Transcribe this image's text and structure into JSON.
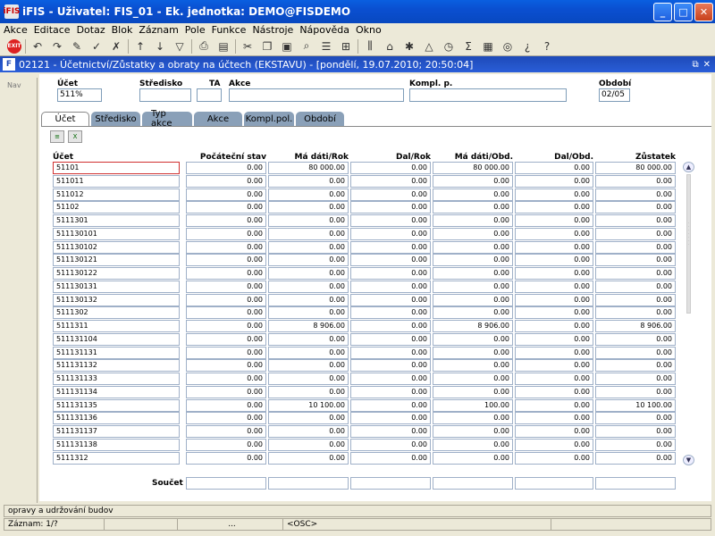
{
  "window": {
    "title": "iFIS - Uživatel: FIS_01 - Ek. jednotka: DEMO@FISDEMO",
    "app_icon": "iFIS"
  },
  "menu": [
    "Akce",
    "Editace",
    "Dotaz",
    "Blok",
    "Záznam",
    "Pole",
    "Funkce",
    "Nástroje",
    "Nápověda",
    "Okno"
  ],
  "toolbar": {
    "exit_label": "EXIT"
  },
  "child_window": {
    "title": "02121 - Účetnictví/Zůstatky a obraty na účtech (EKSTAVU) - [pondělí, 19.07.2010; 20:50:04]"
  },
  "nav": {
    "label": "Nav"
  },
  "filters": {
    "ucet_label": "Účet",
    "ucet_value": "511%",
    "stredisko_label": "Středisko",
    "stredisko_value": "",
    "ta_label": "TA",
    "ta_value": "",
    "akce_label": "Akce",
    "akce_value": "",
    "kompl_label": "Kompl. p.",
    "kompl_value": "",
    "obdobi_label": "Období",
    "obdobi_value": "02/05"
  },
  "tabs": [
    "Účet",
    "Středisko",
    "Typ akce",
    "Akce",
    "Kompl.pol.",
    "Období"
  ],
  "table": {
    "headers": [
      "Účet",
      "Počáteční stav",
      "Má dáti/Rok",
      "Dal/Rok",
      "Má dáti/Obd.",
      "Dal/Obd.",
      "Zůstatek"
    ],
    "rows": [
      [
        "51101",
        "0.00",
        "80 000.00",
        "0.00",
        "80 000.00",
        "0.00",
        "80 000.00"
      ],
      [
        "511011",
        "0.00",
        "0.00",
        "0.00",
        "0.00",
        "0.00",
        "0.00"
      ],
      [
        "511012",
        "0.00",
        "0.00",
        "0.00",
        "0.00",
        "0.00",
        "0.00"
      ],
      [
        "51102",
        "0.00",
        "0.00",
        "0.00",
        "0.00",
        "0.00",
        "0.00"
      ],
      [
        "5111301",
        "0.00",
        "0.00",
        "0.00",
        "0.00",
        "0.00",
        "0.00"
      ],
      [
        "511130101",
        "0.00",
        "0.00",
        "0.00",
        "0.00",
        "0.00",
        "0.00"
      ],
      [
        "511130102",
        "0.00",
        "0.00",
        "0.00",
        "0.00",
        "0.00",
        "0.00"
      ],
      [
        "511130121",
        "0.00",
        "0.00",
        "0.00",
        "0.00",
        "0.00",
        "0.00"
      ],
      [
        "511130122",
        "0.00",
        "0.00",
        "0.00",
        "0.00",
        "0.00",
        "0.00"
      ],
      [
        "511130131",
        "0.00",
        "0.00",
        "0.00",
        "0.00",
        "0.00",
        "0.00"
      ],
      [
        "511130132",
        "0.00",
        "0.00",
        "0.00",
        "0.00",
        "0.00",
        "0.00"
      ],
      [
        "5111302",
        "0.00",
        "0.00",
        "0.00",
        "0.00",
        "0.00",
        "0.00"
      ],
      [
        "5111311",
        "0.00",
        "8 906.00",
        "0.00",
        "8 906.00",
        "0.00",
        "8 906.00"
      ],
      [
        "511131104",
        "0.00",
        "0.00",
        "0.00",
        "0.00",
        "0.00",
        "0.00"
      ],
      [
        "511131131",
        "0.00",
        "0.00",
        "0.00",
        "0.00",
        "0.00",
        "0.00"
      ],
      [
        "511131132",
        "0.00",
        "0.00",
        "0.00",
        "0.00",
        "0.00",
        "0.00"
      ],
      [
        "511131133",
        "0.00",
        "0.00",
        "0.00",
        "0.00",
        "0.00",
        "0.00"
      ],
      [
        "511131134",
        "0.00",
        "0.00",
        "0.00",
        "0.00",
        "0.00",
        "0.00"
      ],
      [
        "511131135",
        "0.00",
        "10 100.00",
        "0.00",
        "100.00",
        "0.00",
        "10 100.00"
      ],
      [
        "511131136",
        "0.00",
        "0.00",
        "0.00",
        "0.00",
        "0.00",
        "0.00"
      ],
      [
        "511131137",
        "0.00",
        "0.00",
        "0.00",
        "0.00",
        "0.00",
        "0.00"
      ],
      [
        "511131138",
        "0.00",
        "0.00",
        "0.00",
        "0.00",
        "0.00",
        "0.00"
      ],
      [
        "5111312",
        "0.00",
        "0.00",
        "0.00",
        "0.00",
        "0.00",
        "0.00"
      ]
    ],
    "sum_label": "Součet"
  },
  "status": {
    "message": "opravy a udržování budov",
    "record": "Záznam: 1/?",
    "ellipsis": "...",
    "osc": "<OSC>"
  },
  "colors": {
    "accent": "#0a5fe0",
    "focus": "#d03030"
  }
}
